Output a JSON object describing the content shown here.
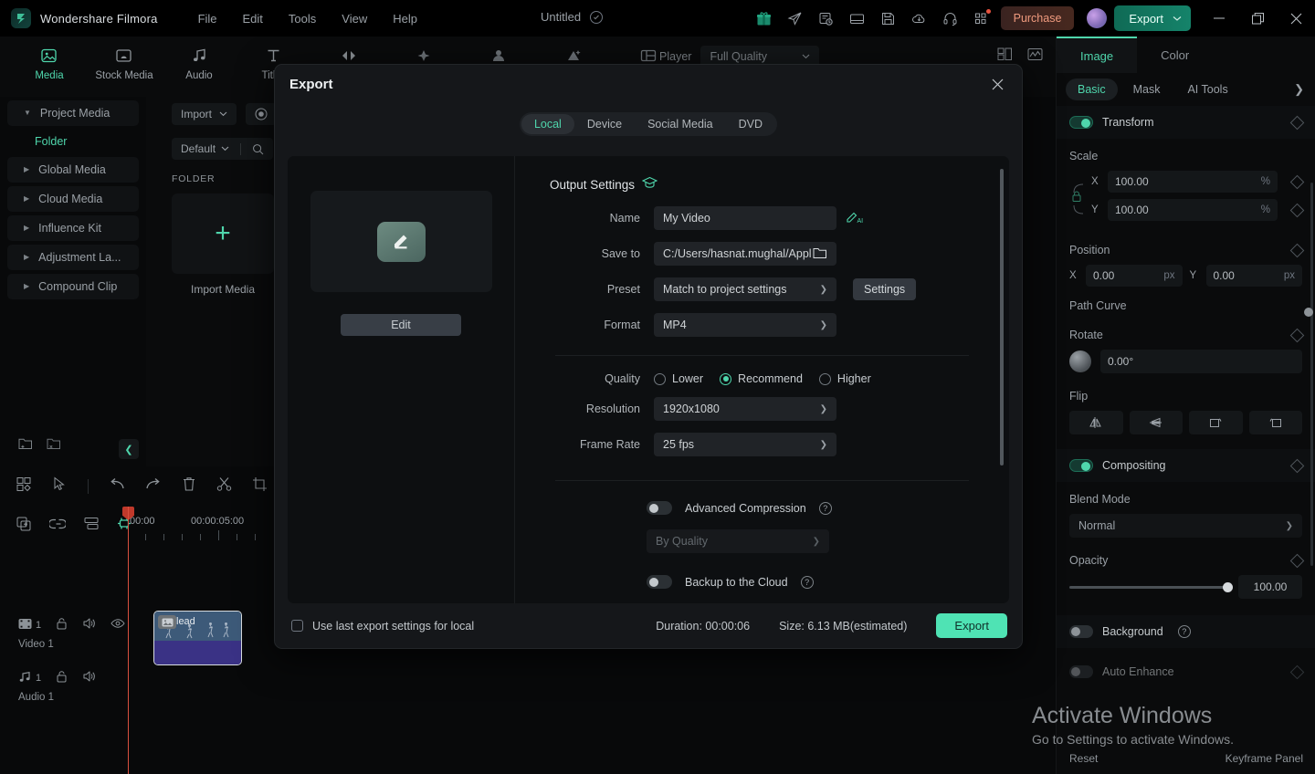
{
  "app": {
    "brand": "Wondershare Filmora",
    "menus": [
      "File",
      "Edit",
      "Tools",
      "View",
      "Help"
    ],
    "doc_title": "Untitled",
    "purchase_label": "Purchase",
    "export_label": "Export",
    "titlebar_icons": [
      "gift-icon",
      "send-icon",
      "task-list-icon",
      "layout-icon",
      "save-icon",
      "cloud-download-icon",
      "headset-icon",
      "apps-grid-icon"
    ],
    "window_controls": [
      "minimize",
      "restore",
      "close"
    ],
    "accent": "#4fd6ac",
    "export_button_color": "#4fe3b4"
  },
  "ribbon": {
    "items": [
      {
        "label": "Media",
        "icon": "media-icon",
        "active": true
      },
      {
        "label": "Stock Media",
        "icon": "stock-media-icon",
        "active": false
      },
      {
        "label": "Audio",
        "icon": "audio-icon",
        "active": false
      },
      {
        "label": "Titles",
        "icon": "titles-icon",
        "active": false
      },
      {
        "label": "Trans",
        "icon": "transitions-icon",
        "active": false
      },
      {
        "label": "",
        "icon": "effects-icon",
        "active": false
      },
      {
        "label": "",
        "icon": "stickers-icon",
        "active": false
      },
      {
        "label": "",
        "icon": "filters-icon",
        "active": false
      },
      {
        "label": "",
        "icon": "templates-icon",
        "active": false
      }
    ]
  },
  "left_nav": {
    "items": [
      {
        "label": "Project Media",
        "expanded": true
      },
      {
        "label": "Global Media",
        "expanded": false
      },
      {
        "label": "Cloud Media",
        "expanded": false
      },
      {
        "label": "Influence Kit",
        "expanded": false
      },
      {
        "label": "Adjustment La...",
        "expanded": false
      },
      {
        "label": "Compound Clip",
        "expanded": false
      }
    ],
    "sub_item": "Folder",
    "footer_icons": [
      "new-folder-icon",
      "delete-folder-icon"
    ],
    "collapse_icon": "chevron-left-icon"
  },
  "media_panel": {
    "import_label": "Import",
    "sort_label": "Default",
    "section_label": "FOLDER",
    "tile_label": "Import Media",
    "search_icon": "search-icon",
    "record_icon": "record-icon"
  },
  "player": {
    "label": "Player",
    "quality": "Full Quality",
    "right_icons": [
      "split-view-icon",
      "waveform-icon"
    ]
  },
  "right_panel": {
    "tabs": [
      {
        "label": "Image",
        "active": true
      },
      {
        "label": "Color",
        "active": false
      }
    ],
    "subtabs": [
      {
        "label": "Basic",
        "active": true
      },
      {
        "label": "Mask",
        "active": false
      },
      {
        "label": "AI Tools",
        "active": false
      }
    ],
    "more_icon": "chevron-right-icon",
    "transform": {
      "title": "Transform",
      "enabled": true,
      "scale_label": "Scale",
      "scale_x_axis": "X",
      "scale_x": "100.00",
      "scale_x_unit": "%",
      "scale_y_axis": "Y",
      "scale_y": "100.00",
      "scale_y_unit": "%",
      "position_label": "Position",
      "pos_x_axis": "X",
      "pos_x": "0.00",
      "pos_x_unit": "px",
      "pos_y_axis": "Y",
      "pos_y": "0.00",
      "pos_y_unit": "px",
      "path_curve_label": "Path Curve",
      "path_curve_enabled": false,
      "rotate_label": "Rotate",
      "rotate_value": "0.00°",
      "flip_label": "Flip",
      "flip_buttons": [
        "flip-horizontal-icon",
        "flip-vertical-icon",
        "rotate-right-icon",
        "rotate-left-icon"
      ]
    },
    "compositing": {
      "title": "Compositing",
      "enabled": true,
      "blend_mode_label": "Blend Mode",
      "blend_mode_value": "Normal",
      "opacity_label": "Opacity",
      "opacity_value": "100.00"
    },
    "background": {
      "title": "Background",
      "enabled": false,
      "auto_enhance": "Auto Enhance"
    },
    "footer": {
      "reset": "Reset",
      "keyframe_panel": "Keyframe Panel"
    }
  },
  "timeline": {
    "toolbar_icons": [
      "templates-icon",
      "select-tool-icon",
      "undo-icon",
      "redo-icon",
      "delete-icon",
      "split-icon",
      "crop-icon"
    ],
    "row2_icons": [
      "duplicate-icon",
      "link-icon",
      "align-icon",
      "marker-icon"
    ],
    "ruler_labels": [
      "00:00",
      "00:00:05:00"
    ],
    "tracks": [
      {
        "name": "Video 1",
        "count": "1",
        "icons": [
          "video-track-icon",
          "lock-icon",
          "mute-icon",
          "eye-icon"
        ]
      },
      {
        "name": "Audio 1",
        "count": "1",
        "icons": [
          "audio-track-icon",
          "lock-icon",
          "mute-icon"
        ]
      }
    ],
    "clip_title": "lead"
  },
  "watermark": {
    "line1": "Activate Windows",
    "line2": "Go to Settings to activate Windows."
  },
  "export_dialog": {
    "title": "Export",
    "close_icon": "close-icon",
    "tabs": [
      {
        "label": "Local",
        "active": true
      },
      {
        "label": "Device",
        "active": false
      },
      {
        "label": "Social Media",
        "active": false
      },
      {
        "label": "DVD",
        "active": false
      }
    ],
    "preview": {
      "edit_button": "Edit",
      "thumb_icon": "edit-pencil-icon"
    },
    "output_settings": {
      "heading": "Output Settings",
      "heading_icon": "graduation-cap-icon",
      "fields": [
        {
          "label": "Name",
          "value": "My Video",
          "type": "text",
          "trailing_icon": "ai-pencil-icon"
        },
        {
          "label": "Save to",
          "value": "C:/Users/hasnat.mughal/Appl",
          "type": "path",
          "trailing_icon": "folder-icon"
        },
        {
          "label": "Preset",
          "value": "Match to project settings",
          "type": "select",
          "button": "Settings"
        },
        {
          "label": "Format",
          "value": "MP4",
          "type": "select"
        }
      ],
      "quality": {
        "label": "Quality",
        "options": [
          "Lower",
          "Recommend",
          "Higher"
        ],
        "selected": "Recommend"
      },
      "resolution": {
        "label": "Resolution",
        "value": "1920x1080"
      },
      "frame_rate": {
        "label": "Frame Rate",
        "value": "25 fps"
      },
      "advanced_compression": {
        "label": "Advanced Compression",
        "enabled": false,
        "help_icon": "help-icon"
      },
      "compression_mode": {
        "placeholder": "By Quality"
      },
      "backup_cloud": {
        "label": "Backup to the Cloud",
        "enabled": false,
        "help_icon": "help-icon"
      }
    },
    "footer": {
      "use_last_settings": "Use last export settings for local",
      "duration": "Duration: 00:00:06",
      "size": "Size: 6.13 MB(estimated)",
      "export_button": "Export"
    }
  }
}
